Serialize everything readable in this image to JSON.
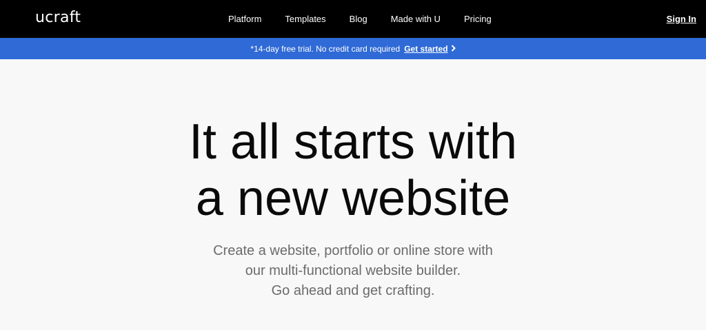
{
  "nav": {
    "logo": "ucraft",
    "links": [
      "Platform",
      "Templates",
      "Blog",
      "Made with U",
      "Pricing"
    ],
    "sign_in": "Sign In"
  },
  "promo": {
    "text": "*14-day free trial. No credit card required",
    "cta": "Get started",
    "cta_icon": "chevron-right-icon"
  },
  "hero": {
    "headline_line1": "It all starts with",
    "headline_line2": "a new website",
    "sub_line1": "Create a website, portfolio or online store with",
    "sub_line2": "our multi-functional website builder.",
    "sub_line3": "Go ahead and get crafting."
  },
  "colors": {
    "nav_bg": "#000000",
    "promo_bg": "#2f6ad6",
    "page_bg": "#f8f8f8",
    "headline": "#0a0a0a",
    "subtext": "#6b6b6b"
  }
}
